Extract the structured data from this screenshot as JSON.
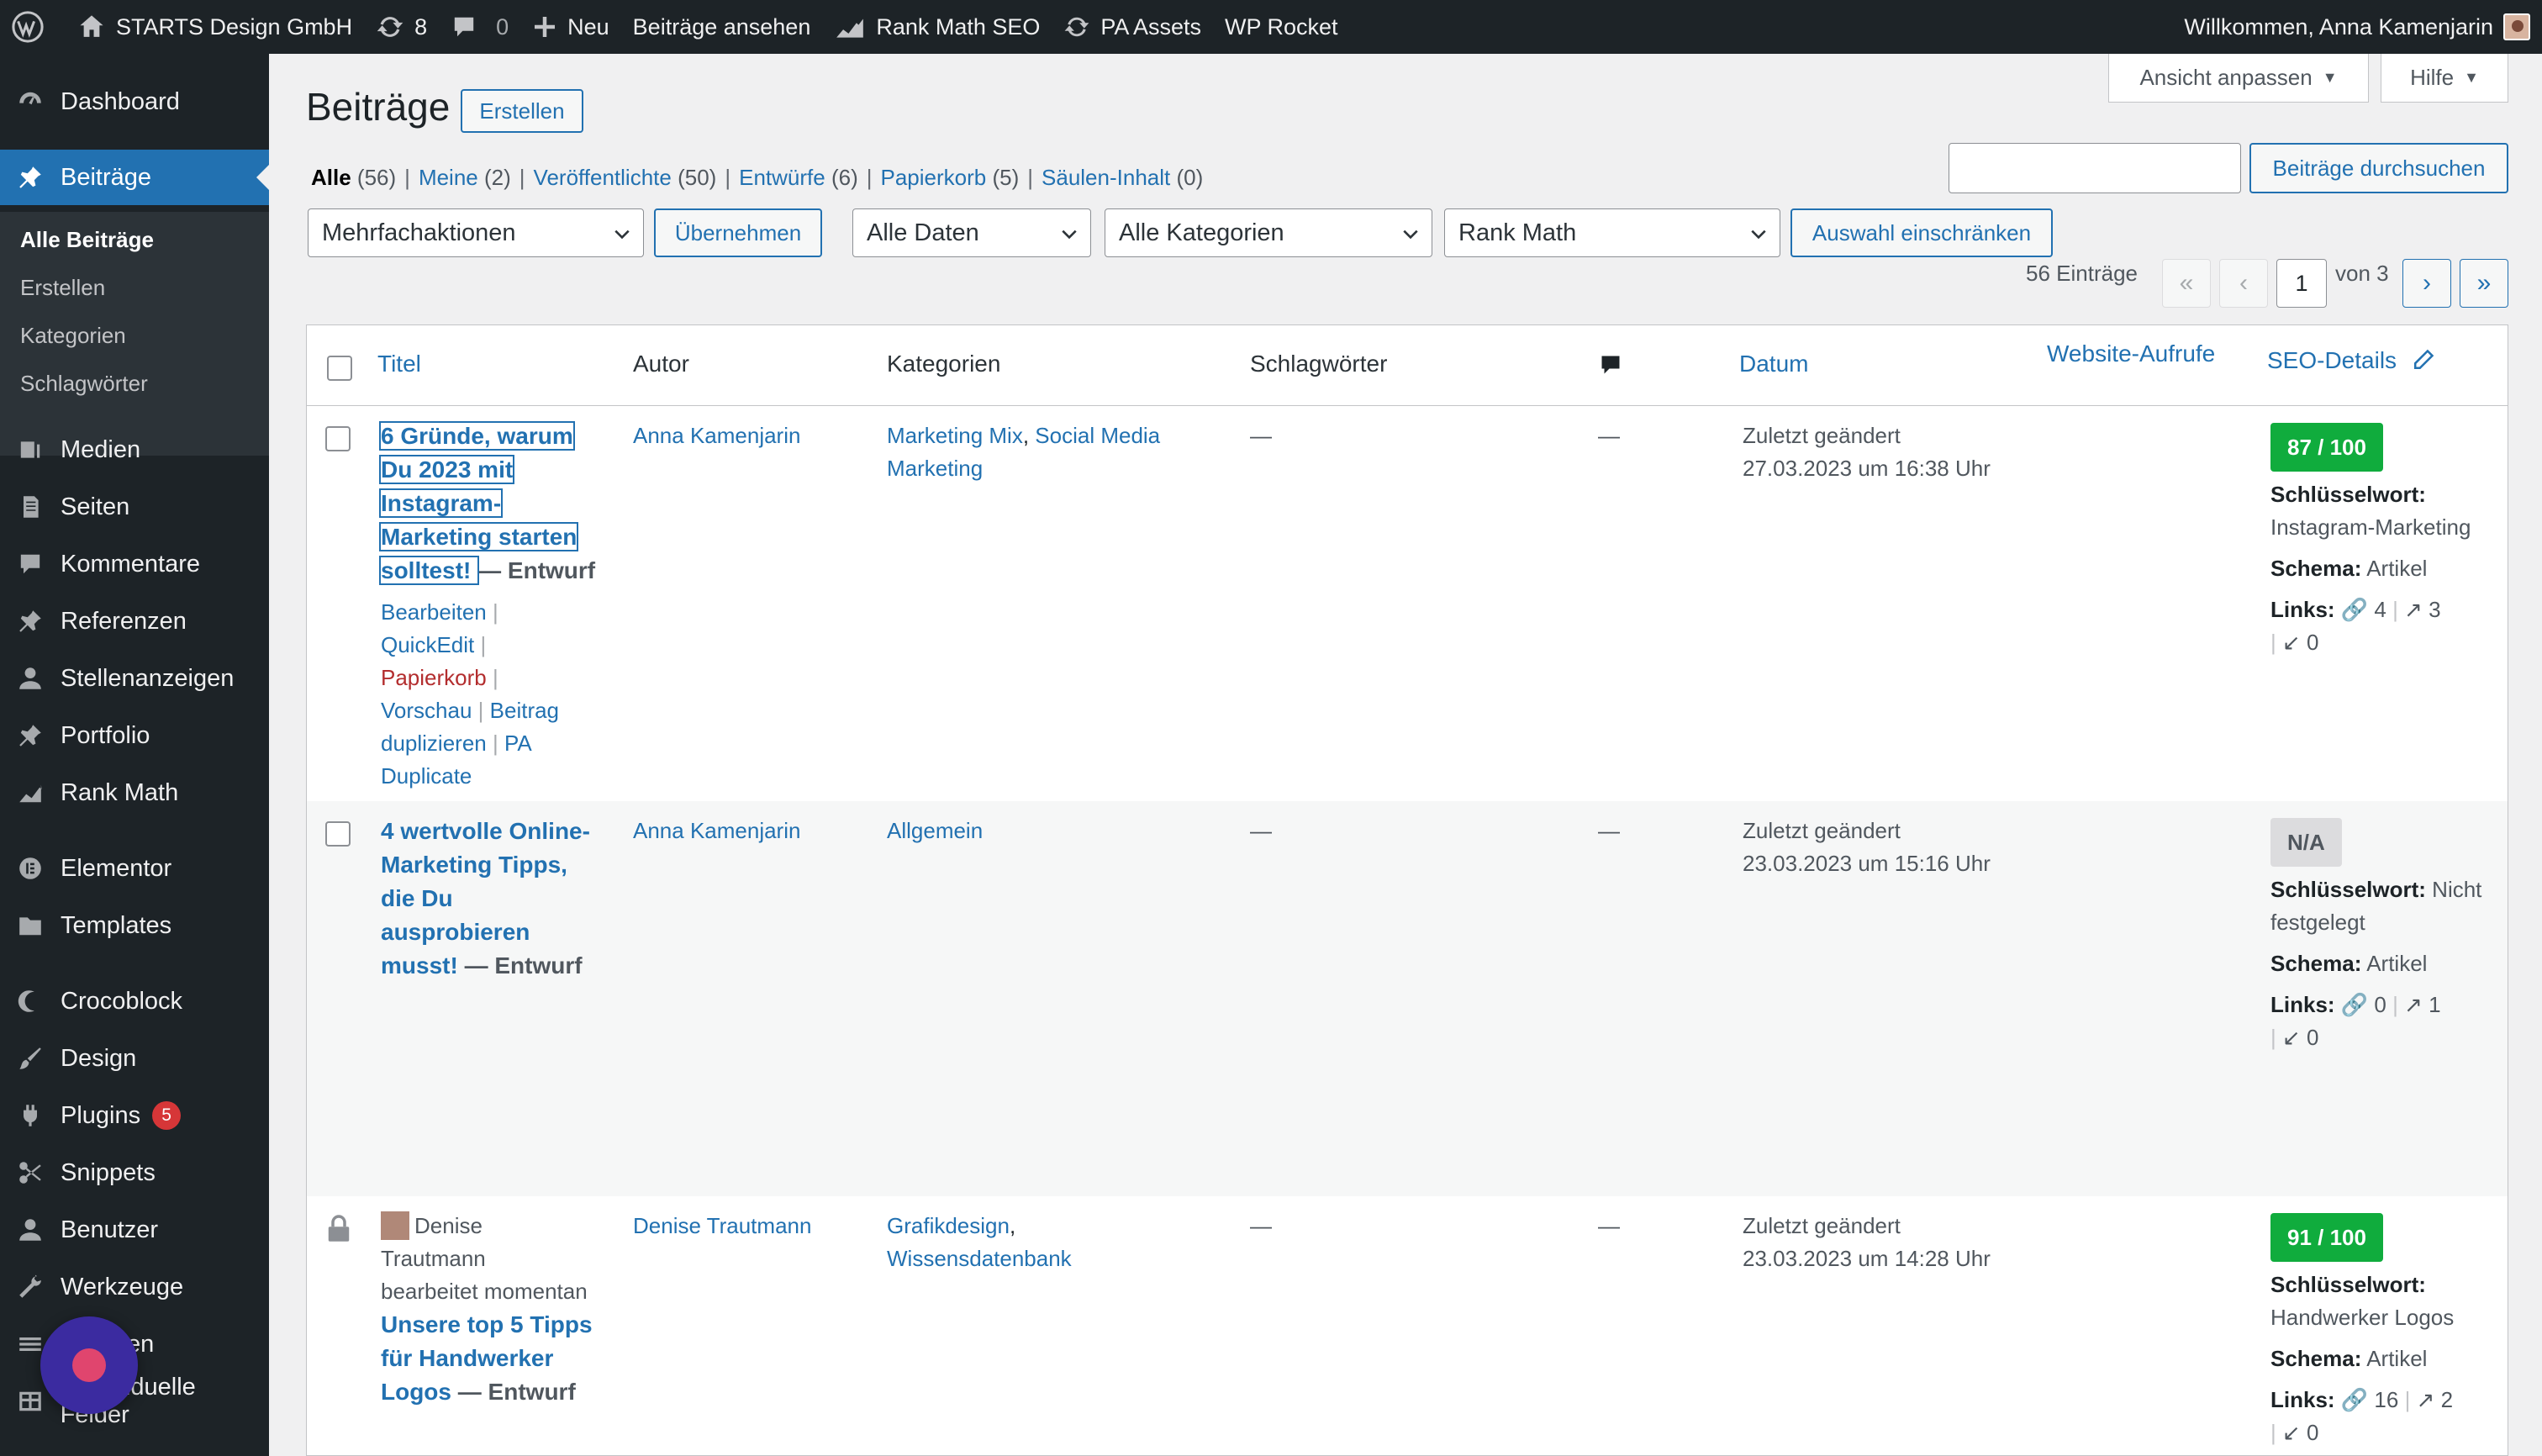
{
  "adminbar": {
    "site_name": "STARTS Design GmbH",
    "updates_count": "8",
    "comments_count": "0",
    "new_label": "Neu",
    "view_posts_label": "Beiträge ansehen",
    "rankmath_label": "Rank Math SEO",
    "pa_assets_label": "PA Assets",
    "wp_rocket_label": "WP Rocket",
    "greeting": "Willkommen, Anna Kamenjarin"
  },
  "sidebar": {
    "items": [
      {
        "label": "Dashboard",
        "icon": "dashboard-icon"
      },
      {
        "label": "Beiträge",
        "icon": "pin-icon"
      },
      {
        "label": "Medien",
        "icon": "media-icon"
      },
      {
        "label": "Seiten",
        "icon": "pages-icon"
      },
      {
        "label": "Kommentare",
        "icon": "comments-icon"
      },
      {
        "label": "Referenzen",
        "icon": "pin-icon"
      },
      {
        "label": "Stellenanzeigen",
        "icon": "user-icon"
      },
      {
        "label": "Portfolio",
        "icon": "pin-icon"
      },
      {
        "label": "Rank Math",
        "icon": "chart-icon"
      },
      {
        "label": "Elementor",
        "icon": "elementor-icon"
      },
      {
        "label": "Templates",
        "icon": "folder-icon"
      },
      {
        "label": "Crocoblock",
        "icon": "crocoblock-icon"
      },
      {
        "label": "Design",
        "icon": "brush-icon"
      },
      {
        "label": "Plugins",
        "icon": "plugin-icon",
        "badge": "5"
      },
      {
        "label": "Snippets",
        "icon": "scissors-icon"
      },
      {
        "label": "Benutzer",
        "icon": "user-icon"
      },
      {
        "label": "Werkzeuge",
        "icon": "wrench-icon"
      },
      {
        "label": "...lungen",
        "icon": "settings-icon"
      },
      {
        "label": "...ndividuelle Felder",
        "icon": "table-icon"
      }
    ],
    "submenu": [
      "Alle Beiträge",
      "Erstellen",
      "Kategorien",
      "Schlagwörter"
    ]
  },
  "screen_meta": {
    "options_label": "Ansicht anpassen",
    "help_label": "Hilfe"
  },
  "header": {
    "title": "Beiträge",
    "add_new_label": "Erstellen"
  },
  "views": [
    {
      "label": "Alle",
      "count": "(56)"
    },
    {
      "label": "Meine",
      "count": "(2)"
    },
    {
      "label": "Veröffentlichte",
      "count": "(50)"
    },
    {
      "label": "Entwürfe",
      "count": "(6)"
    },
    {
      "label": "Papierkorb",
      "count": "(5)"
    },
    {
      "label": "Säulen-Inhalt",
      "count": "(0)"
    }
  ],
  "search": {
    "button_label": "Beiträge durchsuchen",
    "value": ""
  },
  "filters": {
    "bulk_action": "Mehrfachaktionen",
    "apply_label": "Übernehmen",
    "dates": "Alle Daten",
    "categories": "Alle Kategorien",
    "rankmath": "Rank Math",
    "filter_label": "Auswahl einschränken"
  },
  "pagination": {
    "items_count": "56 Einträge",
    "first": "«",
    "prev": "‹",
    "current_page": "1",
    "of_total": "von 3",
    "next": "›",
    "last": "»"
  },
  "table": {
    "columns": {
      "title": "Titel",
      "author": "Autor",
      "categories": "Kategorien",
      "tags": "Schlagwörter",
      "date": "Datum",
      "views": "Website-Aufrufe",
      "seo": "SEO-Details"
    },
    "rows": [
      {
        "title": "6 Gründe, warum Du 2023 mit Instagram-Marketing starten solltest!",
        "title_lines": [
          "6 Gründe, warum",
          "Du 2023 mit",
          "Instagram-",
          "Marketing starten",
          "solltest!"
        ],
        "state": "— Entwurf",
        "actions": {
          "edit": "Bearbeiten",
          "quickedit": "QuickEdit",
          "trash": "Papierkorb",
          "preview": "Vorschau",
          "duplicate_a": "Beitrag",
          "duplicate_b": "duplizieren",
          "pa_a": "PA",
          "pa_b": "Duplicate"
        },
        "author": "Anna Kamenjarin",
        "categories": [
          "Marketing Mix",
          "Social Media Marketing"
        ],
        "tags": "—",
        "comments": "—",
        "date_status": "Zuletzt geändert",
        "date_value": "27.03.2023 um 16:38 Uhr",
        "seo": {
          "score": "87 / 100",
          "score_color": "#10ac3d",
          "keyword_label": "Schlüsselwort:",
          "keyword": "Instagram-Marketing",
          "schema_label": "Schema:",
          "schema": "Artikel",
          "links_label": "Links:",
          "internal": "4",
          "external": "3",
          "incoming": "0"
        }
      },
      {
        "title": "4 wertvolle Online-Marketing Tipps, die Du ausprobieren musst!",
        "title_lines": [
          "4 wertvolle Online-",
          "Marketing Tipps,",
          "die Du",
          "ausprobieren",
          "musst!"
        ],
        "state": "— Entwurf",
        "author": "Anna Kamenjarin",
        "categories": [
          "Allgemein"
        ],
        "tags": "—",
        "comments": "—",
        "date_status": "Zuletzt geändert",
        "date_value": "23.03.2023 um 15:16 Uhr",
        "seo": {
          "score": "N/A",
          "score_color": "#dcdcde",
          "keyword_label": "Schlüsselwort:",
          "keyword": "Nicht festgelegt",
          "schema_label": "Schema:",
          "schema": "Artikel",
          "links_label": "Links:",
          "internal": "0",
          "external": "1",
          "incoming": "0"
        }
      },
      {
        "lock_user_a": "Denise",
        "lock_user_b": "Trautmann",
        "lock_text": "bearbeitet momentan",
        "title": "Unsere top 5 Tipps für Handwerker Logos",
        "title_lines": [
          "Unsere top 5 Tipps",
          "für Handwerker",
          "Logos"
        ],
        "state": "— Entwurf",
        "author": "Denise Trautmann",
        "categories": [
          "Grafikdesign",
          "Wissensdatenbank"
        ],
        "tags": "—",
        "comments": "—",
        "date_status": "Zuletzt geändert",
        "date_value": "23.03.2023 um 14:28 Uhr",
        "seo": {
          "score": "91 / 100",
          "score_color": "#10ac3d",
          "keyword_label": "Schlüsselwort:",
          "keyword": "Handwerker Logos",
          "schema_label": "Schema:",
          "schema": "Artikel",
          "links_label": "Links:",
          "internal": "16",
          "external": "2",
          "incoming": "0"
        }
      }
    ]
  },
  "colors": {
    "accent": "#2271b1",
    "sidebar_bg": "#1d2327",
    "seo_good": "#10ac3d",
    "trash": "#b32d2e",
    "plugin_badge": "#d63638"
  }
}
